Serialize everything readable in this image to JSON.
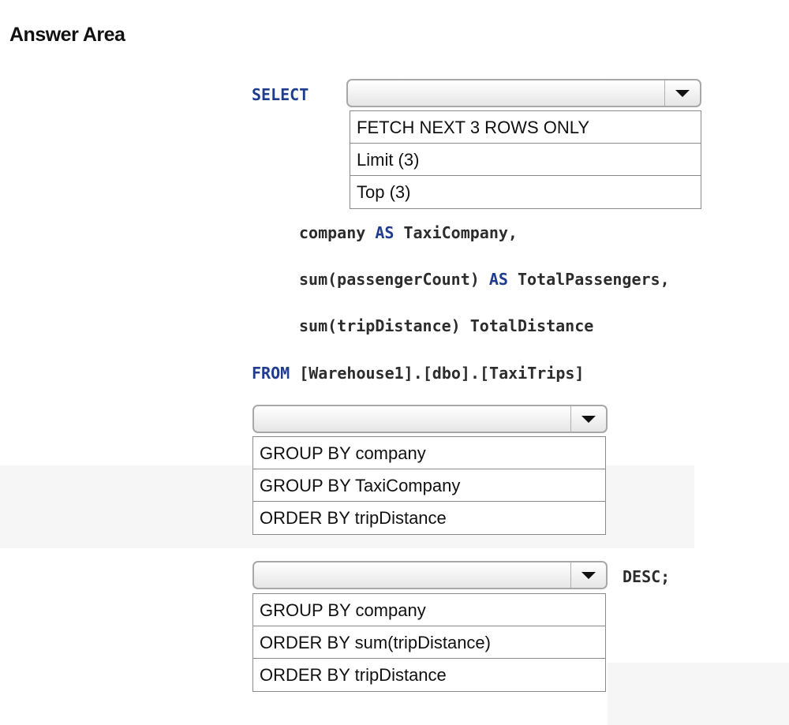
{
  "title": "Answer Area",
  "code": {
    "select_kw": "SELECT",
    "line1_a": "company ",
    "line1_kw": "AS",
    "line1_b": " TaxiCompany,",
    "line2_a": "sum(passengerCount) ",
    "line2_kw": "AS",
    "line2_b": " TotalPassengers,",
    "line3": "sum(tripDistance) TotalDistance",
    "from_kw": "FROM",
    "from_rest": " [Warehouse1].[dbo].[TaxiTrips]",
    "desc": "DESC;"
  },
  "dropdowns": [
    {
      "selected": "",
      "options": [
        "FETCH NEXT 3 ROWS ONLY",
        "Limit (3)",
        "Top (3)"
      ]
    },
    {
      "selected": "",
      "options": [
        "GROUP BY company",
        "GROUP BY TaxiCompany",
        "ORDER BY tripDistance"
      ]
    },
    {
      "selected": "",
      "options": [
        "GROUP BY company",
        "ORDER BY sum(tripDistance)",
        "ORDER BY tripDistance"
      ]
    }
  ]
}
